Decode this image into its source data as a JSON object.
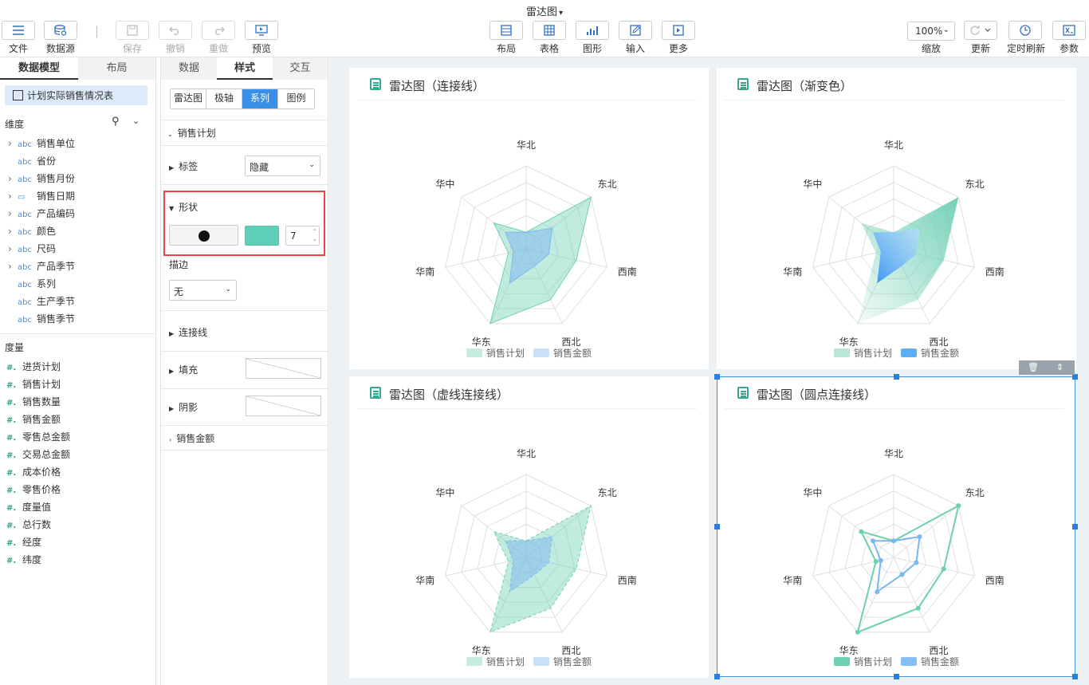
{
  "app": {
    "doc_title": "雷达图"
  },
  "toolbar": {
    "left": [
      {
        "label": "文件",
        "icon": "menu-icon"
      },
      {
        "label": "数据源",
        "icon": "database-icon"
      }
    ],
    "history": [
      {
        "label": "保存",
        "icon": "save-icon"
      },
      {
        "label": "撤销",
        "icon": "undo-icon"
      },
      {
        "label": "重做",
        "icon": "redo-icon"
      }
    ],
    "preview": {
      "label": "预览",
      "icon": "preview-icon"
    },
    "center": [
      {
        "label": "布局",
        "icon": "layout-icon"
      },
      {
        "label": "表格",
        "icon": "table-icon"
      },
      {
        "label": "图形",
        "icon": "chart-icon"
      },
      {
        "label": "输入",
        "icon": "edit-icon"
      },
      {
        "label": "更多",
        "icon": "more-icon"
      }
    ],
    "zoom": {
      "value": "100%",
      "label": "缩放"
    },
    "right": [
      {
        "label": "更新",
        "icon": "refresh-icon"
      },
      {
        "label": "定时刷新",
        "icon": "clock-icon"
      },
      {
        "label": "参数",
        "icon": "param-icon"
      }
    ]
  },
  "left_panel": {
    "tabs": [
      "数据模型",
      "布局"
    ],
    "dataset": "计划实际销售情况表",
    "dim_header": "维度",
    "dimensions": [
      {
        "label": "销售单位",
        "type": "abc",
        "expand": true
      },
      {
        "label": "省份",
        "type": "abc",
        "expand": false
      },
      {
        "label": "销售月份",
        "type": "abc",
        "expand": true
      },
      {
        "label": "销售日期",
        "type": "date",
        "expand": true
      },
      {
        "label": "产品编码",
        "type": "abc",
        "expand": true
      },
      {
        "label": "颜色",
        "type": "abc",
        "expand": true
      },
      {
        "label": "尺码",
        "type": "abc",
        "expand": true
      },
      {
        "label": "产品季节",
        "type": "abc",
        "expand": true
      },
      {
        "label": "系列",
        "type": "abc",
        "expand": false
      },
      {
        "label": "生产季节",
        "type": "abc",
        "expand": false
      },
      {
        "label": "销售季节",
        "type": "abc",
        "expand": false
      }
    ],
    "measure_header": "度量",
    "measures": [
      "进货计划",
      "销售计划",
      "销售数量",
      "销售金额",
      "零售总金额",
      "交易总金额",
      "成本价格",
      "零售价格",
      "度量值",
      "总行数",
      "经度",
      "纬度"
    ]
  },
  "mid_panel": {
    "tabs": [
      "数据",
      "样式",
      "交互"
    ],
    "subtabs": [
      "雷达图",
      "极轴",
      "系列",
      "图例"
    ],
    "series_name": "销售计划",
    "label_title": "标签",
    "label_value": "隐藏",
    "shape_title": "形状",
    "shape_size": "7",
    "stroke_title": "描边",
    "stroke_value": "无",
    "line_title": "连接线",
    "fill_title": "填充",
    "shadow_title": "阴影",
    "series2_name": "销售金额",
    "shape_color": "#5ecfb9"
  },
  "charts": [
    {
      "title": "雷达图（连接线）",
      "style": "area"
    },
    {
      "title": "雷达图（渐变色）",
      "style": "gradient"
    },
    {
      "title": "雷达图（虚线连接线）",
      "style": "dashed"
    },
    {
      "title": "雷达图（圆点连接线）",
      "style": "dots"
    }
  ],
  "chart_data": [
    {
      "type": "radar",
      "title": "雷达图（连接线）",
      "categories": [
        "华北",
        "东北",
        "西南",
        "西北",
        "华东",
        "华南",
        "华中"
      ],
      "ylim": [
        0,
        100
      ],
      "legend": "bottom",
      "series": [
        {
          "name": "销售计划",
          "color": "#6dcfb4",
          "values": [
            20,
            100,
            62,
            68,
            100,
            22,
            50
          ]
        },
        {
          "name": "销售金额",
          "color": "#7ab7f0",
          "values": [
            20,
            40,
            28,
            23,
            46,
            16,
            32
          ]
        }
      ]
    },
    {
      "type": "radar",
      "title": "雷达图（渐变色）",
      "categories": [
        "华北",
        "东北",
        "西南",
        "西北",
        "华东",
        "华南",
        "华中"
      ],
      "ylim": [
        0,
        100
      ],
      "legend": "bottom",
      "series": [
        {
          "name": "销售计划",
          "color": "#6dcfb4",
          "values": [
            20,
            100,
            62,
            68,
            100,
            22,
            50
          ]
        },
        {
          "name": "销售金额",
          "color": "#4aa6f5",
          "values": [
            20,
            40,
            28,
            23,
            46,
            16,
            32
          ]
        }
      ]
    },
    {
      "type": "radar",
      "title": "雷达图（虚线连接线）",
      "categories": [
        "华北",
        "东北",
        "西南",
        "西北",
        "华东",
        "华南",
        "华中"
      ],
      "ylim": [
        0,
        100
      ],
      "legend": "bottom",
      "series": [
        {
          "name": "销售计划",
          "color": "#6dcfb4",
          "values": [
            20,
            100,
            62,
            68,
            100,
            22,
            50
          ]
        },
        {
          "name": "销售金额",
          "color": "#7ab7f0",
          "values": [
            20,
            40,
            28,
            23,
            46,
            16,
            32
          ]
        }
      ]
    },
    {
      "type": "radar",
      "title": "雷达图（圆点连接线）",
      "categories": [
        "华北",
        "东北",
        "西南",
        "西北",
        "华东",
        "华南",
        "华中"
      ],
      "ylim": [
        0,
        100
      ],
      "legend": "bottom",
      "series": [
        {
          "name": "销售计划",
          "color": "#6dcfb4",
          "values": [
            20,
            100,
            62,
            68,
            100,
            22,
            50
          ]
        },
        {
          "name": "销售金额",
          "color": "#7ab7f0",
          "values": [
            20,
            40,
            28,
            23,
            46,
            16,
            32
          ]
        }
      ]
    }
  ]
}
